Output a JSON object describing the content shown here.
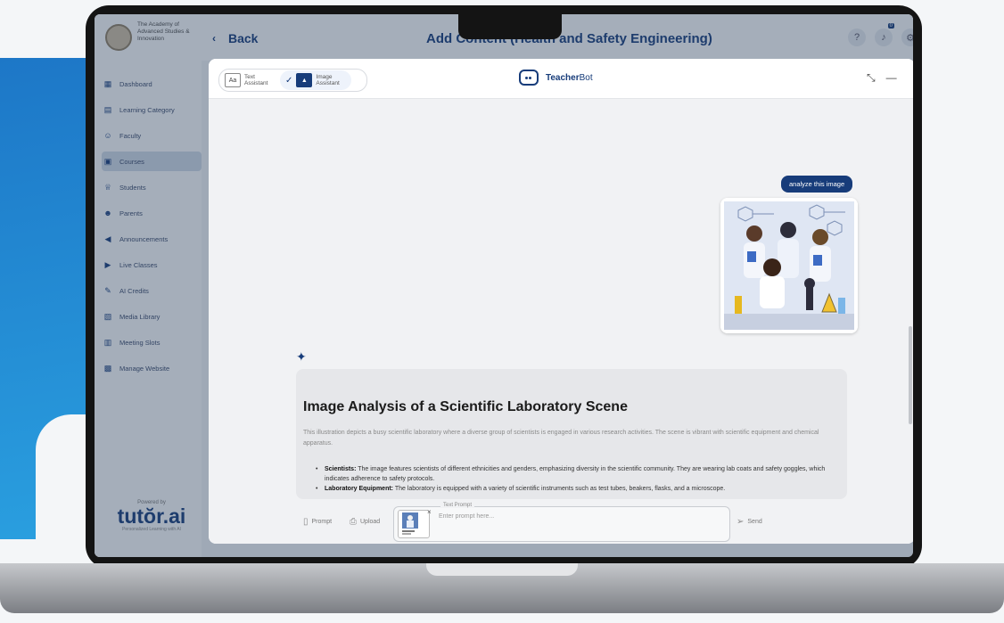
{
  "app": {
    "org_name": "The Academy of Advanced Studies & Innovation",
    "back_label": "Back",
    "page_title": "Add Content (Health and Safety Engineering)",
    "notification_count": "0"
  },
  "sidebar": {
    "items": [
      {
        "label": "Dashboard",
        "icon": "grid-icon"
      },
      {
        "label": "Learning Category",
        "icon": "book-icon"
      },
      {
        "label": "Faculty",
        "icon": "person-icon"
      },
      {
        "label": "Courses",
        "icon": "course-icon",
        "active": true
      },
      {
        "label": "Students",
        "icon": "graduation-icon"
      },
      {
        "label": "Parents",
        "icon": "people-icon"
      },
      {
        "label": "Announcements",
        "icon": "megaphone-icon"
      },
      {
        "label": "Live Classes",
        "icon": "play-icon"
      },
      {
        "label": "AI Credits",
        "icon": "credits-icon"
      },
      {
        "label": "Media Library",
        "icon": "media-icon"
      },
      {
        "label": "Meeting Slots",
        "icon": "calendar-icon"
      },
      {
        "label": "Manage Website",
        "icon": "website-icon"
      }
    ],
    "powered_by": "Powered by",
    "brand": "tutŏr.ai",
    "brand_tagline": "Personalized Learning with AI"
  },
  "modal": {
    "toggle": {
      "text_assistant": "Text Assistant",
      "image_assistant": "Image Assistant",
      "selected": "image_assistant"
    },
    "bot_name_bold": "Teacher",
    "bot_name_rest": "Bot",
    "chat": {
      "user_message": "analyze this image",
      "answer_title": "Image Analysis of a Scientific Laboratory Scene",
      "answer_intro": "This illustration depicts a busy scientific laboratory where a diverse group of scientists is engaged in various research activities. The scene is vibrant with scientific equipment and chemical apparatus.",
      "answer_points": [
        {
          "term": "Scientists:",
          "text": " The image features scientists of different ethnicities and genders, emphasizing diversity in the scientific community. They are wearing lab coats and safety goggles, which indicates adherence to safety protocols."
        },
        {
          "term": "Laboratory Equipment:",
          "text": " The laboratory is equipped with a variety of scientific instruments such as test tubes, beakers, flasks, and a microscope."
        }
      ]
    },
    "input": {
      "prompt_label": "Prompt",
      "upload_label": "Upload",
      "field_label": "Text Prompt",
      "placeholder": "Enter prompt here...",
      "send_label": "Send"
    }
  },
  "colors": {
    "brand_navy": "#173c7a",
    "blob_blue": "#1d77c7"
  }
}
